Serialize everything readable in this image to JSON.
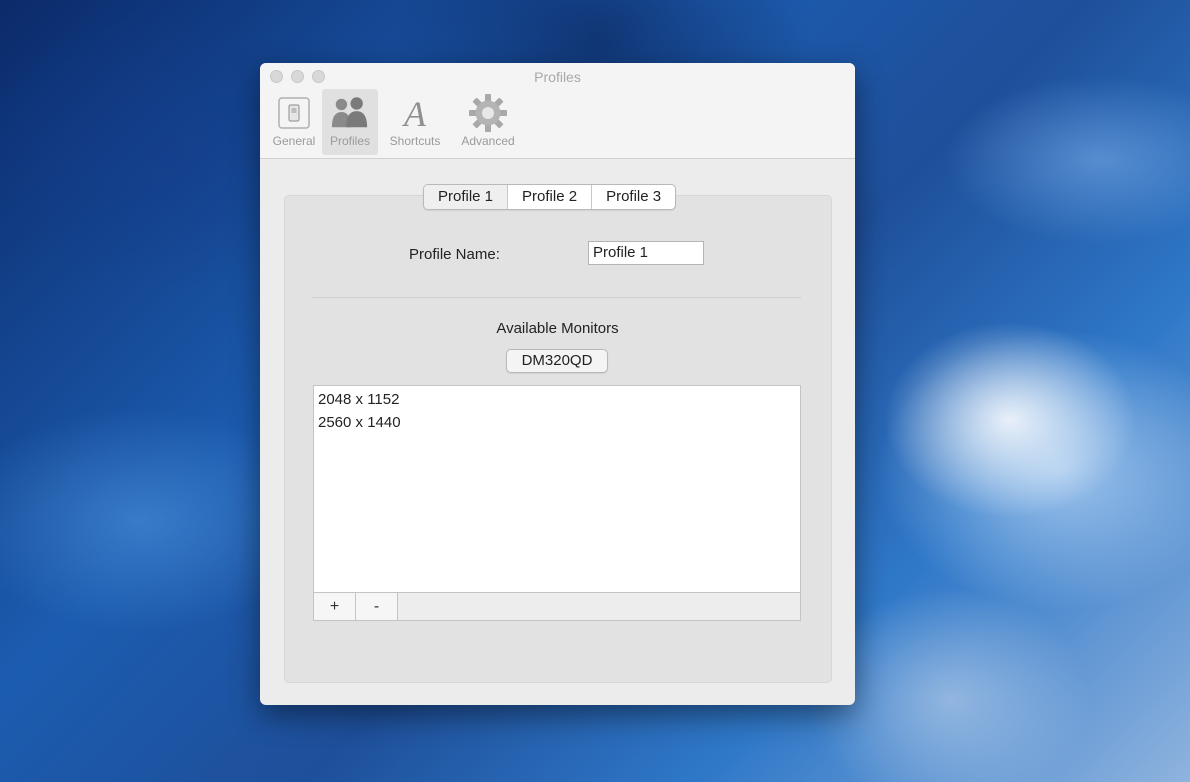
{
  "window": {
    "title": "Profiles"
  },
  "toolbar": {
    "items": [
      {
        "label": "General",
        "icon": "switch-icon"
      },
      {
        "label": "Profiles",
        "icon": "users-icon"
      },
      {
        "label": "Shortcuts",
        "icon": "font-a-icon"
      },
      {
        "label": "Advanced",
        "icon": "gear-icon"
      }
    ],
    "selected": "Profiles"
  },
  "profile_tabs": [
    "Profile 1",
    "Profile 2",
    "Profile 3"
  ],
  "profile_tabs_selected": "Profile 1",
  "profile_name": {
    "label": "Profile Name:",
    "value": "Profile 1"
  },
  "monitors": {
    "heading": "Available Monitors",
    "selected_monitor": "DM320QD",
    "resolutions": [
      "2048 x 1152",
      "2560 x 1440"
    ],
    "add_label": "+",
    "remove_label": "-"
  }
}
